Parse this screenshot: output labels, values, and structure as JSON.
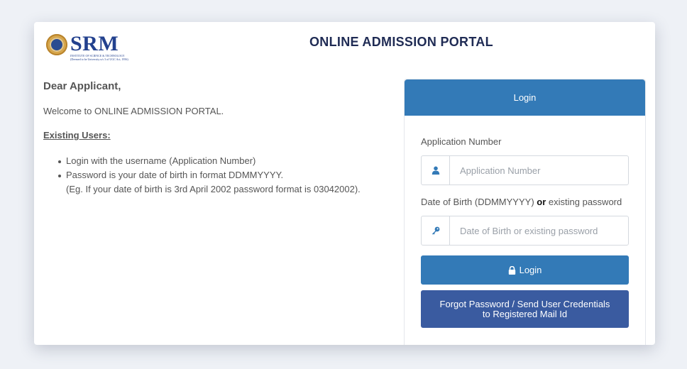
{
  "header": {
    "logo_text": "SRM",
    "logo_line1": "INSTITUTE OF SCIENCE & TECHNOLOGY",
    "logo_line2": "(Deemed to be University u/s 3 of UGC Act, 1956)",
    "title": "ONLINE ADMISSION PORTAL"
  },
  "intro": {
    "greeting": "Dear Applicant,",
    "welcome": "Welcome to ONLINE ADMISSION PORTAL.",
    "existing_users": "Existing Users:",
    "bullets": [
      "Login with the username (Application Number)",
      "Password is your date of birth in format DDMMYYYY."
    ],
    "note": "(Eg. If your date of birth is 3rd April 2002 password format is 03042002)."
  },
  "login": {
    "panel_title": "Login",
    "app_number_label": "Application Number",
    "app_number_placeholder": "Application Number",
    "dob_label_prefix": "Date of Birth (DDMMYYYY)",
    "dob_label_or": "or",
    "dob_label_suffix": "existing password",
    "dob_placeholder": "Date of Birth or existing password",
    "login_button": "Login",
    "forgot_button": "Forgot Password / Send User Credentials to Registered Mail Id"
  },
  "icons": {
    "user": "user-icon",
    "key": "key-icon",
    "lock": "lock-icon"
  },
  "colors": {
    "primary": "#337ab7",
    "secondary": "#3a5ba0",
    "title": "#1f2b54"
  }
}
